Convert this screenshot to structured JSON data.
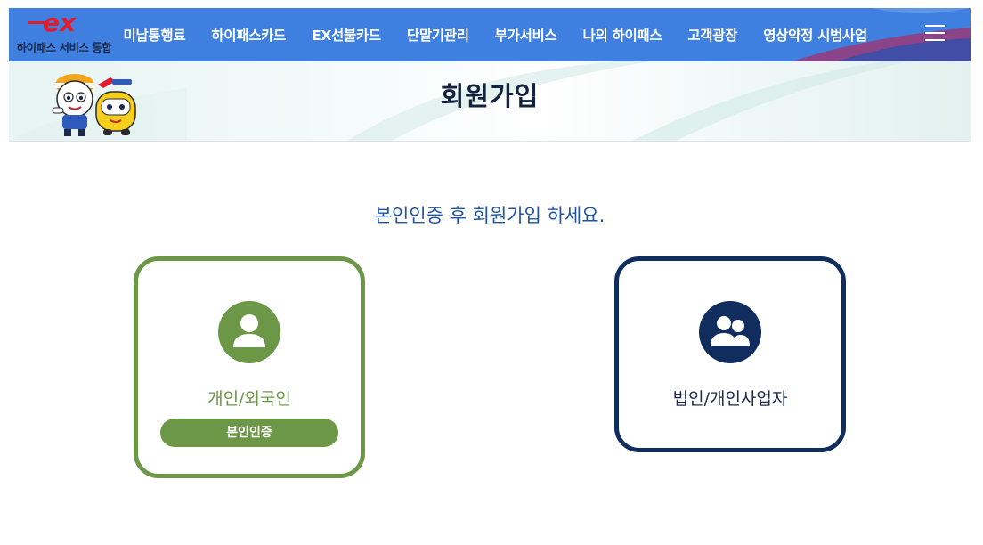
{
  "header": {
    "logo_text": "하이패스 서비스 통합",
    "logo_mark": "ex",
    "menu": [
      {
        "label": "미납통행료"
      },
      {
        "label": "하이패스카드"
      },
      {
        "label": "EX선불카드"
      },
      {
        "label": "단말기관리"
      },
      {
        "label": "부가서비스"
      },
      {
        "label": "나의 하이패스"
      },
      {
        "label": "고객광장"
      },
      {
        "label": "영상약정 시범사업"
      }
    ],
    "menu_icon": "hamburger-icon"
  },
  "banner": {
    "title": "회원가입",
    "mascot": "highway-mascot-characters"
  },
  "main": {
    "subtitle": "본인인증 후 회원가입 하세요.",
    "cards": [
      {
        "label": "개인/외국인",
        "icon": "person-icon",
        "button_label": "본인인증",
        "accent": "#6b9747"
      },
      {
        "label": "법인/개인사업자",
        "icon": "group-icon",
        "accent": "#112d5e"
      }
    ]
  },
  "colors": {
    "nav_bg": "#3f7fe0",
    "title_text": "#12223f",
    "subtitle_text": "#2254a6"
  }
}
